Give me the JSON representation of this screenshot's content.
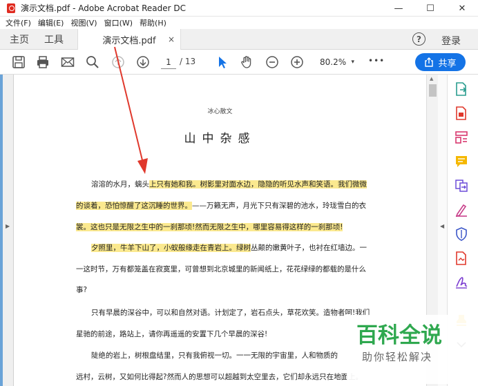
{
  "window": {
    "title": "演示文档.pdf - Adobe Acrobat Reader DC",
    "minimize": "—",
    "maximize": "☐",
    "close": "✕"
  },
  "menu": [
    "文件(F)",
    "编辑(E)",
    "视图(V)",
    "窗口(W)",
    "帮助(H)"
  ],
  "tabs": {
    "home": "主页",
    "tools": "工具",
    "document": "演示文档.pdf",
    "close": "×",
    "help": "?",
    "login": "登录"
  },
  "toolbar": {
    "page_current": "1",
    "page_total": "/ 13",
    "zoom": "80.2%",
    "zoom_arrow": "▾",
    "more": "•••",
    "share": "共享"
  },
  "document": {
    "subtitle": "冰心散文",
    "heading": "山中杂感",
    "lines": [
      {
        "plain": "溶溶的水月，螭头",
        "hl": "上只有她和我。树影里对面水边，隐隐的听见水声和笑语。我们微微",
        "tail": ""
      },
      {
        "plain": "",
        "hl": "的谈着，恐怕惊醒了这沉睡的世界。",
        "tail": "——万籁无声，月光下只有深碧的池水，玲珑雪白的衣"
      },
      {
        "plain": "",
        "hl": "裳。这也只是无限之生中的一刹那顷!然而无限之生中，哪里容易得这样的一刹那顷!",
        "tail": ""
      },
      {
        "plain": "",
        "hl": "夕照里，牛羊下山了，小蚁般缘走在青岩上。绿树",
        "tail": "丛颠的嫩黄叶子，也衬在红墙边。一"
      },
      {
        "plain": "一这时节，万有都笼盖在寂寞里，可曾想到北京城里的新闻纸上，花花绿绿的都载的是什么",
        "hl": "",
        "tail": ""
      },
      {
        "plain": "事?",
        "hl": "",
        "tail": ""
      },
      {
        "plain": "只有早晨的深谷中，可以和自然对语。计划定了，岩石点头，草花欢笑。造物者呵!我们",
        "hl": "",
        "tail": ""
      },
      {
        "plain": "星驰的前途，路站上，请你再遥遥的安置下几个早晨的深谷!",
        "hl": "",
        "tail": ""
      },
      {
        "plain": "陡绝的岩上，树根盘结里，只有我俯视一切。一一无限的宇宙里，人和物质的",
        "hl": "",
        "tail": ""
      },
      {
        "plain": "远村，云树，又如何比得起?然而人的思想可以超越到太空里去，它们却永远只在地面上。",
        "hl": "",
        "tail": ""
      }
    ]
  },
  "watermark": {
    "logo": "百科全说",
    "sub": "助你轻松解决"
  },
  "colors": {
    "accent": "#1473e6",
    "highlight": "#fbe98f",
    "annotation": "#e0382c"
  }
}
